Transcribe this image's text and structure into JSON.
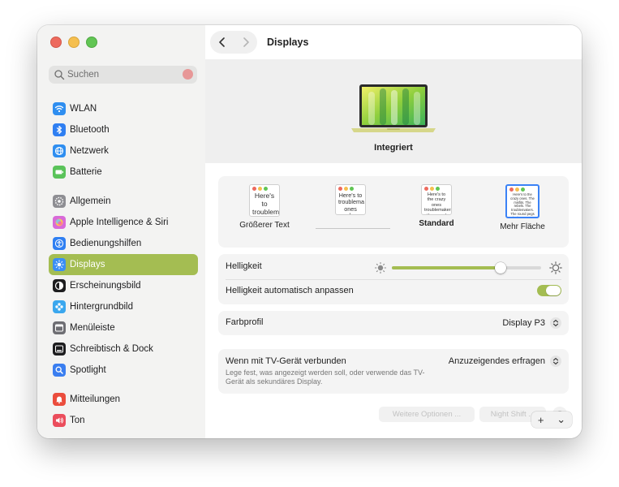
{
  "window": {
    "title": "Displays"
  },
  "search": {
    "placeholder": "Suchen"
  },
  "sidebar": {
    "groups": [
      [
        {
          "label": "WLAN",
          "icon": "wifi-icon",
          "color": "#2f8ef0"
        },
        {
          "label": "Bluetooth",
          "icon": "bluetooth-icon",
          "color": "#2f7ff2"
        },
        {
          "label": "Netzwerk",
          "icon": "globe-icon",
          "color": "#2f8ef0"
        },
        {
          "label": "Batterie",
          "icon": "battery-icon",
          "color": "#5ac35a"
        }
      ],
      [
        {
          "label": "Allgemein",
          "icon": "gear-icon",
          "color": "#8e8e93"
        },
        {
          "label": "Apple Intelligence & Siri",
          "icon": "siri-icon",
          "color": "#d86ad8"
        },
        {
          "label": "Bedienungshilfen",
          "icon": "accessibility-icon",
          "color": "#2f7ff2"
        },
        {
          "label": "Displays",
          "icon": "sun-icon",
          "color": "#3a8ef5",
          "active": true
        },
        {
          "label": "Erscheinungsbild",
          "icon": "appearance-icon",
          "color": "#1d1d1f"
        },
        {
          "label": "Hintergrundbild",
          "icon": "flower-icon",
          "color": "#3aa7ee"
        },
        {
          "label": "Menüleiste",
          "icon": "menubar-icon",
          "color": "#6e6e73"
        },
        {
          "label": "Schreibtisch & Dock",
          "icon": "dock-icon",
          "color": "#1d1d1f"
        },
        {
          "label": "Spotlight",
          "icon": "spotlight-icon",
          "color": "#3a7ef0"
        }
      ],
      [
        {
          "label": "Mitteilungen",
          "icon": "bell-icon",
          "color": "#eb4d3d"
        },
        {
          "label": "Ton",
          "icon": "speaker-icon",
          "color": "#eb4d5c"
        }
      ]
    ]
  },
  "display": {
    "name": "Integriert"
  },
  "resolution": {
    "options": [
      {
        "label": "Größerer Text",
        "sample": "Here's to troublem",
        "selected": false
      },
      {
        "label": "",
        "sample": "Here's to troublema ones who",
        "selected": false
      },
      {
        "label": "Standard",
        "sample": "Here's to the crazy ones troublemakers, the round ones who see things diff rules. And they have no",
        "selected": false
      },
      {
        "label": "Mehr Fläche",
        "sample": "Here's to the crazy ones. The misfits. The rebels. The troublemakers. The round pegs in the square holes. The ones who see things differently. They're not fond of rules. And they have no respect for the status quo.",
        "selected": true
      }
    ]
  },
  "brightness": {
    "label": "Helligkeit",
    "value": 0.73,
    "auto_label": "Helligkeit automatisch anpassen",
    "auto_enabled": true
  },
  "color_profile": {
    "label": "Farbprofil",
    "value": "Display P3"
  },
  "tv": {
    "label": "Wenn mit TV-Gerät verbunden",
    "value": "Anzuzeigendes erfragen",
    "description": "Lege fest, was angezeigt werden soll, oder verwende das TV-Gerät als sekundäres Display."
  },
  "footer": {
    "advanced_label": "Weitere Optionen ...",
    "night_shift_label": "Night Shift ...",
    "help_label": "?",
    "add_label": "+",
    "menu_label": "⌄"
  },
  "colors": {
    "accent": "#a4bd52"
  }
}
